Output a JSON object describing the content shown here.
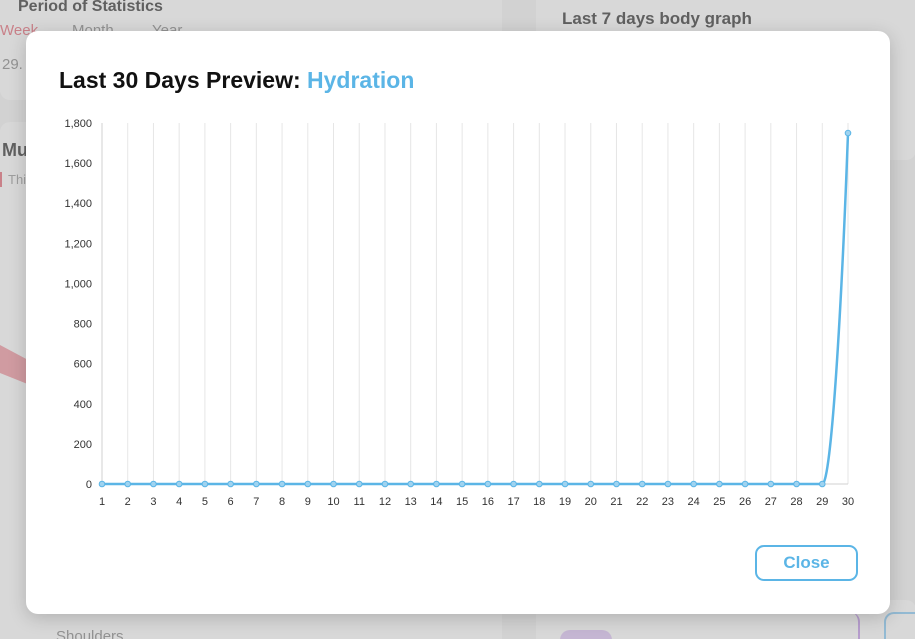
{
  "background": {
    "period_title": "Period of Statistics",
    "tabs": [
      "Week",
      "Month",
      "Year"
    ],
    "date_snippet": "29.",
    "body_graph_title": "Last 7 days body graph",
    "muscle_title": "Mu",
    "this_tab": "Thi",
    "shoulders_label": "Shoulders"
  },
  "modal": {
    "title_prefix": "Last 30 Days Preview: ",
    "metric_name": "Hydration",
    "close_label": "Close"
  },
  "colors": {
    "accent": "#5bb5e6",
    "line": "#5bb5e6"
  },
  "chart_data": {
    "type": "line",
    "title": "",
    "xlabel": "",
    "ylabel": "",
    "x": [
      1,
      2,
      3,
      4,
      5,
      6,
      7,
      8,
      9,
      10,
      11,
      12,
      13,
      14,
      15,
      16,
      17,
      18,
      19,
      20,
      21,
      22,
      23,
      24,
      25,
      26,
      27,
      28,
      29,
      30
    ],
    "series": [
      {
        "values": [
          0,
          0,
          0,
          0,
          0,
          0,
          0,
          0,
          0,
          0,
          0,
          0,
          0,
          0,
          0,
          0,
          0,
          0,
          0,
          0,
          0,
          0,
          0,
          0,
          0,
          0,
          0,
          0,
          0,
          1750
        ]
      }
    ],
    "ylim": [
      0,
      1800
    ],
    "yticks": [
      "0",
      "200",
      "400",
      "600",
      "800",
      "1,000",
      "1,200",
      "1,400",
      "1,600",
      "1,800"
    ],
    "grid": "vertical",
    "legend": "none"
  }
}
